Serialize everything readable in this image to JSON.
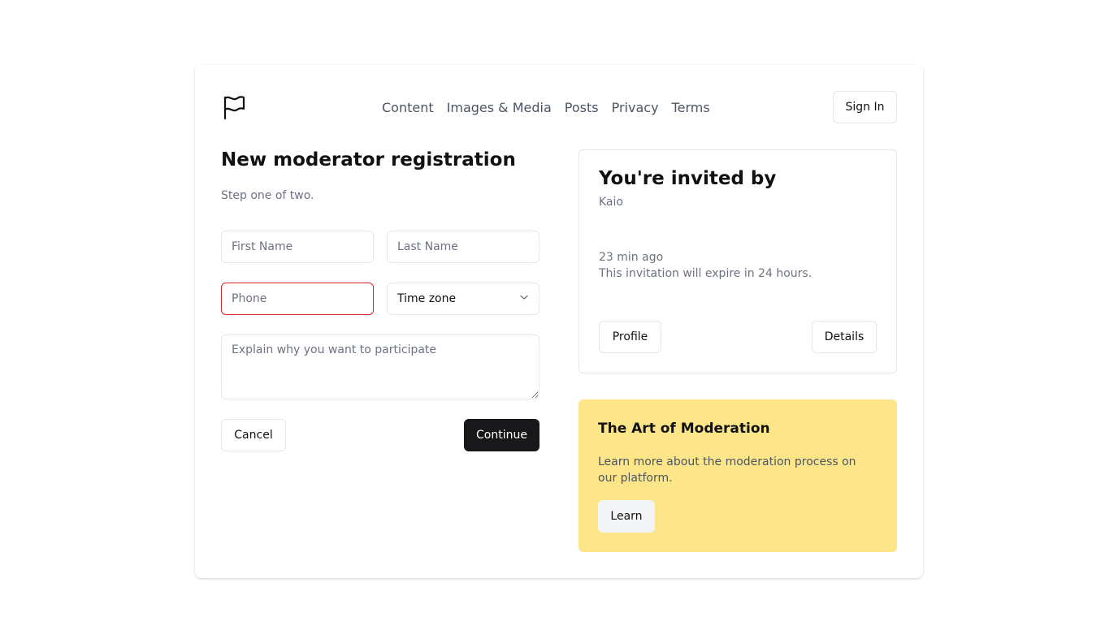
{
  "header": {
    "logo_icon": "flag-icon",
    "nav": [
      "Content",
      "Images & Media",
      "Posts",
      "Privacy",
      "Terms"
    ],
    "sign_in_label": "Sign In"
  },
  "form": {
    "title": "New moderator registration",
    "subtitle": "Step one of two.",
    "first_name_placeholder": "First Name",
    "last_name_placeholder": "Last Name",
    "phone_placeholder": "Phone",
    "phone_error_color": "#dc2626",
    "timezone_label": "Time zone",
    "reason_placeholder": "Explain why you want to participate",
    "cancel_label": "Cancel",
    "continue_label": "Continue"
  },
  "invite": {
    "title": "You're invited by",
    "inviter": "Kaio",
    "time_ago": "23 min ago",
    "expiry": "This invitation will expire in 24 hours.",
    "profile_label": "Profile",
    "details_label": "Details"
  },
  "promo": {
    "title": "The Art of Moderation",
    "text": "Learn more about the moderation process on our platform.",
    "learn_label": "Learn",
    "background_color": "#fde68a"
  },
  "colors": {
    "primary_button": "#18181b",
    "border": "#e5e7eb",
    "muted_text": "#6b7280"
  }
}
